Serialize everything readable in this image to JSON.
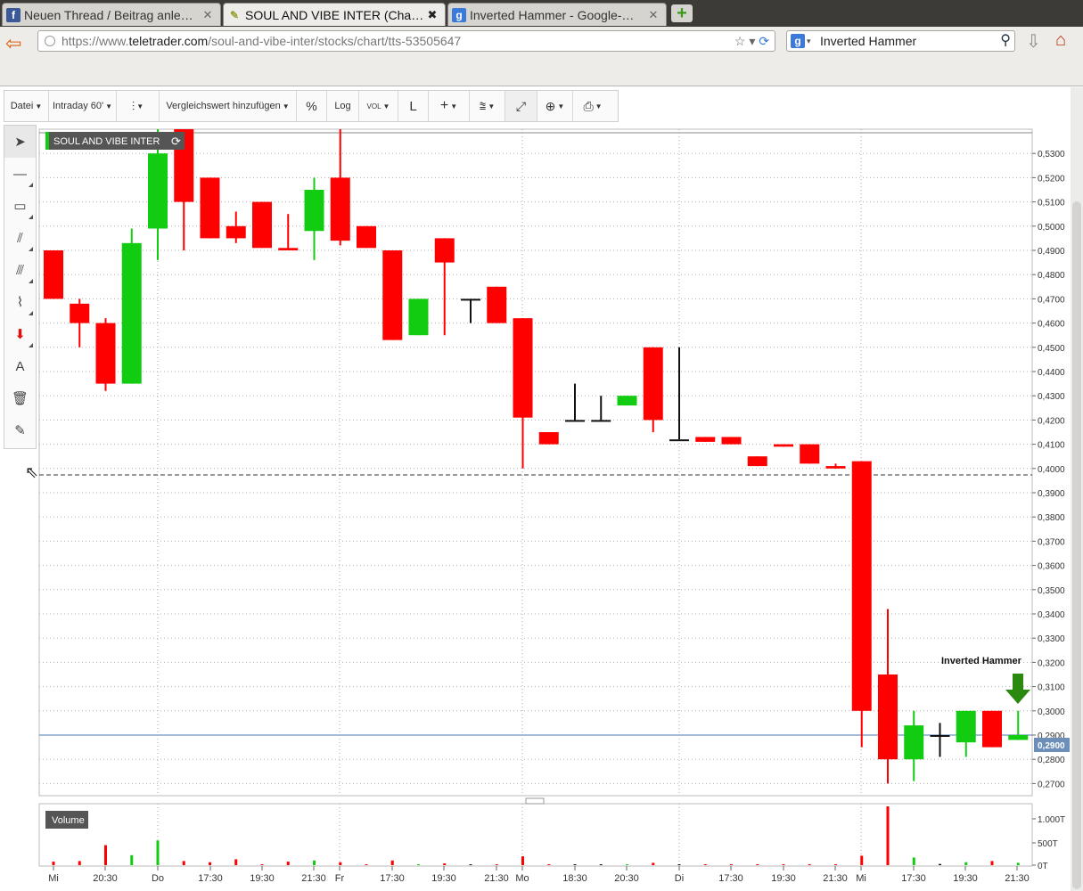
{
  "browser": {
    "tabs": [
      {
        "title": "Neuen Thread / Beitrag anle…",
        "icon": "facebook-icon",
        "color": "#3b5998",
        "glyph": "f"
      },
      {
        "title": "SOUL AND VIBE INTER (Cha…",
        "icon": "teletrader-icon",
        "color": "#c8d060",
        "glyph": "✎"
      },
      {
        "title": "Inverted Hammer - Google-…",
        "icon": "google-icon",
        "color": "#3b7ad9",
        "glyph": "g"
      }
    ],
    "url_prefix": "https://www.",
    "url_domain": "teletrader.com",
    "url_path": "/soul-and-vibe-inter/stocks/chart/tts-53505647",
    "search_value": "Inverted Hammer"
  },
  "toolbar": {
    "file": "Datei",
    "interval": "Intraday 60'",
    "compare": "Vergleichswert hinzufügen",
    "percent": "%",
    "log": "Log",
    "vol": "VOL",
    "line": "L"
  },
  "left_tools": [
    "pointer-tool",
    "line-tool",
    "rectangle-tool",
    "fan-tool",
    "channel-tool",
    "wave-tool",
    "arrow-tool",
    "text-tool",
    "delete-tool",
    "pencil-tool"
  ],
  "chart_data": {
    "type": "candlestick",
    "title": "SOUL AND VIBE INTER",
    "volume_label": "Volume",
    "annotation": "Inverted Hammer",
    "last_price": "0,2900",
    "reference_line": 0.4,
    "ylim": [
      0.265,
      0.54
    ],
    "y_ticks": [
      0.27,
      0.28,
      0.29,
      0.3,
      0.31,
      0.32,
      0.33,
      0.34,
      0.35,
      0.36,
      0.37,
      0.38,
      0.39,
      0.4,
      0.41,
      0.42,
      0.43,
      0.44,
      0.45,
      0.46,
      0.47,
      0.48,
      0.49,
      0.5,
      0.51,
      0.52,
      0.53
    ],
    "y_tick_labels": [
      "0,2700",
      "0,2800",
      "0,2900",
      "0,3000",
      "0,3100",
      "0,3200",
      "0,3300",
      "0,3400",
      "0,3500",
      "0,3600",
      "0,3700",
      "0,3800",
      "0,3900",
      "0,4000",
      "0,4100",
      "0,4200",
      "0,4300",
      "0,4400",
      "0,4500",
      "0,4600",
      "0,4700",
      "0,4800",
      "0,4900",
      "0,5000",
      "0,5100",
      "0,5200",
      "0,5300"
    ],
    "volume_ticks": [
      "1.000T",
      "500T",
      "0T"
    ],
    "x_labels": [
      "Mi",
      "20:30",
      "Do",
      "17:30",
      "19:30",
      "21:30",
      "Fr",
      "17:30",
      "19:30",
      "21:30",
      "Mo",
      "18:30",
      "20:30",
      "Di",
      "17:30",
      "19:30",
      "21:30",
      "Mi",
      "17:30",
      "19:30",
      "21:30"
    ],
    "day_separator_labels": [
      "Do",
      "Fr",
      "Mo",
      "Di",
      "Mi"
    ],
    "candles": [
      {
        "o": 0.49,
        "h": 0.49,
        "l": 0.47,
        "c": 0.47,
        "v": 60
      },
      {
        "o": 0.468,
        "h": 0.47,
        "l": 0.45,
        "c": 0.46,
        "v": 70
      },
      {
        "o": 0.46,
        "h": 0.462,
        "l": 0.432,
        "c": 0.435,
        "v": 340
      },
      {
        "o": 0.435,
        "h": 0.499,
        "l": 0.435,
        "c": 0.493,
        "v": 170
      },
      {
        "o": 0.499,
        "h": 0.54,
        "l": 0.486,
        "c": 0.53,
        "v": 420
      },
      {
        "o": 0.54,
        "h": 0.54,
        "l": 0.49,
        "c": 0.51,
        "v": 70
      },
      {
        "o": 0.52,
        "h": 0.52,
        "l": 0.495,
        "c": 0.495,
        "v": 50
      },
      {
        "o": 0.5,
        "h": 0.506,
        "l": 0.493,
        "c": 0.495,
        "v": 100
      },
      {
        "o": 0.51,
        "h": 0.51,
        "l": 0.491,
        "c": 0.491,
        "v": 0
      },
      {
        "o": 0.491,
        "h": 0.505,
        "l": 0.49,
        "c": 0.49,
        "v": 60
      },
      {
        "o": 0.498,
        "h": 0.52,
        "l": 0.486,
        "c": 0.515,
        "v": 80
      },
      {
        "o": 0.52,
        "h": 0.54,
        "l": 0.492,
        "c": 0.494,
        "v": 50
      },
      {
        "o": 0.5,
        "h": 0.5,
        "l": 0.491,
        "c": 0.491,
        "v": 0
      },
      {
        "o": 0.49,
        "h": 0.49,
        "l": 0.453,
        "c": 0.453,
        "v": 80
      },
      {
        "o": 0.455,
        "h": 0.47,
        "l": 0.455,
        "c": 0.47,
        "v": 0
      },
      {
        "o": 0.495,
        "h": 0.495,
        "l": 0.455,
        "c": 0.485,
        "v": 30
      },
      {
        "o": 0.47,
        "h": 0.47,
        "l": 0.46,
        "c": 0.47,
        "v": 0
      },
      {
        "o": 0.475,
        "h": 0.475,
        "l": 0.46,
        "c": 0.46,
        "v": 0
      },
      {
        "o": 0.462,
        "h": 0.462,
        "l": 0.4,
        "c": 0.421,
        "v": 150
      },
      {
        "o": 0.415,
        "h": 0.415,
        "l": 0.41,
        "c": 0.41,
        "v": 0
      },
      {
        "o": 0.42,
        "h": 0.435,
        "l": 0.42,
        "c": 0.42,
        "v": 0
      },
      {
        "o": 0.42,
        "h": 0.43,
        "l": 0.42,
        "c": 0.42,
        "v": 0
      },
      {
        "o": 0.426,
        "h": 0.43,
        "l": 0.426,
        "c": 0.43,
        "v": 0
      },
      {
        "o": 0.45,
        "h": 0.45,
        "l": 0.415,
        "c": 0.42,
        "v": 40
      },
      {
        "o": 0.412,
        "h": 0.45,
        "l": 0.412,
        "c": 0.412,
        "v": 0
      },
      {
        "o": 0.413,
        "h": 0.413,
        "l": 0.411,
        "c": 0.411,
        "v": 0
      },
      {
        "o": 0.413,
        "h": 0.413,
        "l": 0.41,
        "c": 0.41,
        "v": 0
      },
      {
        "o": 0.405,
        "h": 0.405,
        "l": 0.401,
        "c": 0.401,
        "v": 0
      },
      {
        "o": 0.41,
        "h": 0.41,
        "l": 0.409,
        "c": 0.409,
        "v": 0
      },
      {
        "o": 0.41,
        "h": 0.41,
        "l": 0.402,
        "c": 0.402,
        "v": 0
      },
      {
        "o": 0.401,
        "h": 0.402,
        "l": 0.4,
        "c": 0.4,
        "v": 0
      },
      {
        "o": 0.403,
        "h": 0.403,
        "l": 0.285,
        "c": 0.3,
        "v": 160
      },
      {
        "o": 0.315,
        "h": 0.342,
        "l": 0.27,
        "c": 0.28,
        "v": 1000
      },
      {
        "o": 0.28,
        "h": 0.3,
        "l": 0.271,
        "c": 0.294,
        "v": 130
      },
      {
        "o": 0.29,
        "h": 0.295,
        "l": 0.281,
        "c": 0.29,
        "v": 20
      },
      {
        "o": 0.287,
        "h": 0.3,
        "l": 0.281,
        "c": 0.3,
        "v": 50
      },
      {
        "o": 0.3,
        "h": 0.3,
        "l": 0.285,
        "c": 0.285,
        "v": 70
      },
      {
        "o": 0.288,
        "h": 0.3,
        "l": 0.288,
        "c": 0.29,
        "v": 40
      }
    ],
    "colors": {
      "up": "#11cc11",
      "down": "#ff0000",
      "flat": "#111111",
      "grid": "#b0b0b0",
      "price_line": "#4a7ab0",
      "price_tag": "#6b8fb8",
      "annotation_arrow": "#2a8a10"
    }
  }
}
